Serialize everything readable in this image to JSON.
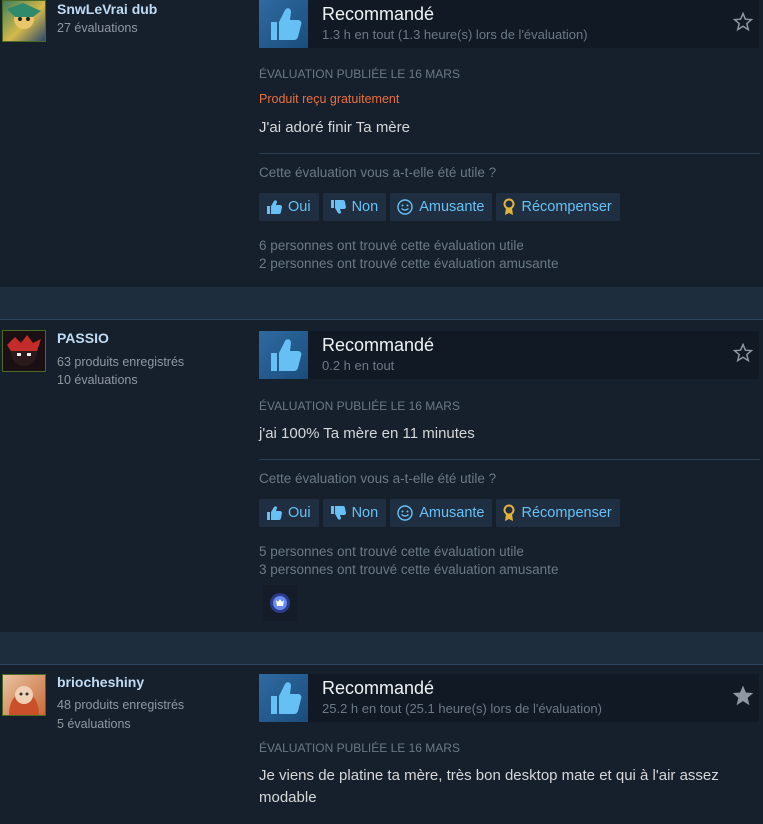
{
  "reviews": [
    {
      "username": "SnwLeVrai dub",
      "meta1": "27 évaluations",
      "meta2": "",
      "recommendation": "Recommandé",
      "hours": "1.3 h en tout (1.3 heure(s) lors de l'évaluation)",
      "posted": "Évaluation publiée le 16 mars",
      "free_label": "Produit reçu gratuitement",
      "content": "J'ai adoré finir Ta mère",
      "helpful_question": "Cette évaluation vous a-t-elle été utile ?",
      "buttons": {
        "yes": "Oui",
        "no": "Non",
        "funny": "Amusante",
        "award": "Récompenser"
      },
      "helpful_count": "6 personnes ont trouvé cette évaluation utile",
      "funny_count": "2 personnes ont trouvé cette évaluation amusante"
    },
    {
      "username": "PASSIO",
      "meta1": "63 produits enregistrés",
      "meta2": "10 évaluations",
      "recommendation": "Recommandé",
      "hours": "0.2 h en tout",
      "posted": "Évaluation publiée le 16 mars",
      "content": "j'ai 100% Ta mère en 11 minutes",
      "helpful_question": "Cette évaluation vous a-t-elle été utile ?",
      "buttons": {
        "yes": "Oui",
        "no": "Non",
        "funny": "Amusante",
        "award": "Récompenser"
      },
      "helpful_count": "5 personnes ont trouvé cette évaluation utile",
      "funny_count": "3 personnes ont trouvé cette évaluation amusante"
    },
    {
      "username": "briocheshiny",
      "meta1": "48 produits enregistrés",
      "meta2": "5 évaluations",
      "recommendation": "Recommandé",
      "hours": "25.2 h en tout (25.1 heure(s) lors de l'évaluation)",
      "posted": "Évaluation publiée le 16 mars",
      "content": "Je viens de platine ta mère, très bon desktop mate et qui à l'air assez modable"
    }
  ],
  "icons": {
    "thumbs_up_big": "thumbs-up-icon",
    "star": "star-icon",
    "award_badge": "award-badge-icon"
  },
  "colors": {
    "accent_link": "#67c1f5",
    "free_product": "#e86f3c",
    "thumb_box": "#2f6aa0"
  }
}
